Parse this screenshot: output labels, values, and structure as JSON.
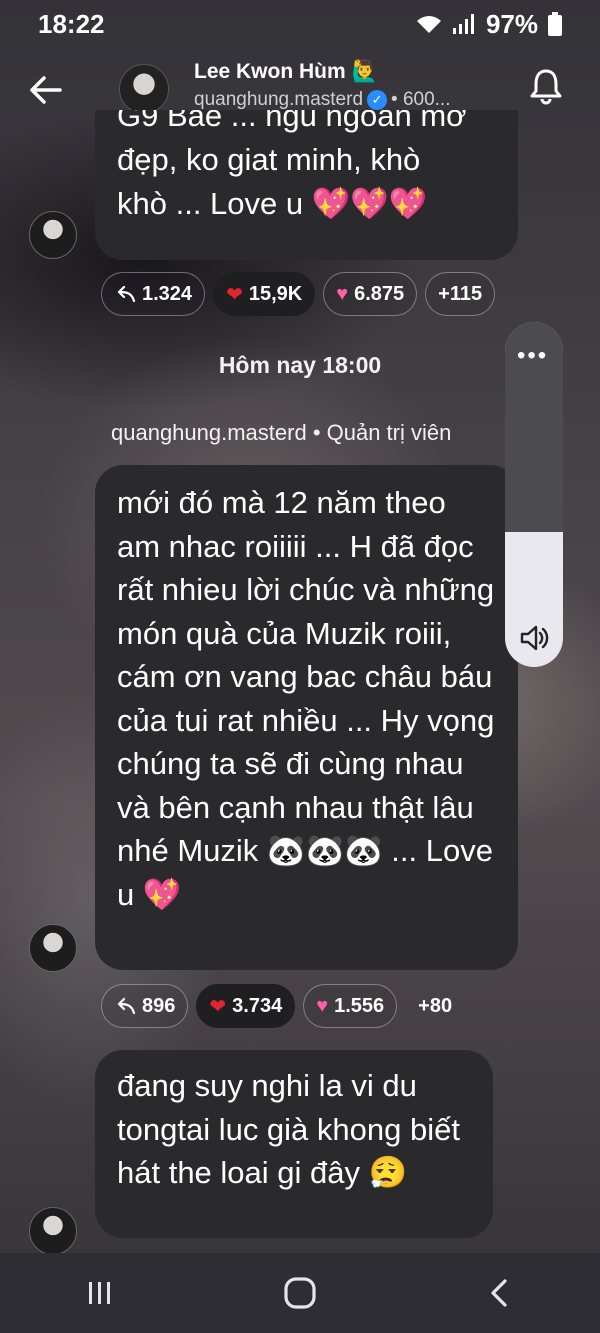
{
  "status_bar": {
    "time": "18:22",
    "battery": "97%"
  },
  "header": {
    "title": "Lee Kwon Hùm 🙋‍♂️",
    "username": "quanghung.masterd",
    "followers": "• 600..."
  },
  "messages": [
    {
      "text_lines": [
        "G9 Bae ... ngu ngoan mơ",
        "đẹp, ko giat minh, khò",
        "khò ... Love u 💖💖💖"
      ],
      "reactions": {
        "replies": "1.324",
        "hearts": "15,9K",
        "sparkle_hearts": "6.875",
        "more": "+115"
      }
    },
    {
      "text": "mới đó mà 12 năm theo am nhac roiiiii ... H đã đọc rất nhieu lời chúc và những món quà của Muzik roiii, cám ơn vang bac châu báu của tui rat nhiều ... Hy vọng chúng ta sẽ đi cùng nhau và bên cạnh nhau thật lâu nhé Muzik 🐼🐼🐼 ... Love u 💖",
      "reactions": {
        "replies": "896",
        "hearts": "3.734",
        "sparkle_hearts": "1.556",
        "more": "+80"
      }
    },
    {
      "text": "đang suy nghi la vi du tongtai luc già khong biết hát the loai gi đây 😮‍💨"
    }
  ],
  "divider": {
    "day_label": "Hôm nay 18:00",
    "sender_line": "quanghung.masterd • Quản trị viên"
  },
  "side_control": {
    "more_label": "•••"
  },
  "colors": {
    "bubble": "#2a2a2d",
    "heart": "#e0272f",
    "pink_heart": "#ff5fa9",
    "verified": "#2a8cff"
  }
}
